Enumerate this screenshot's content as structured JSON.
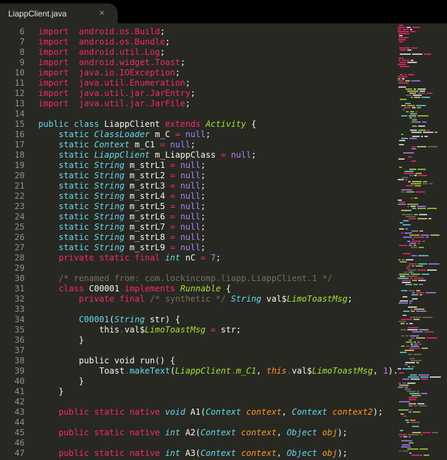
{
  "tab": {
    "filename": "LiappClient.java",
    "close_glyph": "×"
  },
  "lines": [
    {
      "n": "6",
      "tokens": [
        [
          "k",
          "import"
        ],
        [
          "",
          "  "
        ],
        [
          "k",
          "android.os.Build"
        ],
        [
          "",
          ";"
        ]
      ]
    },
    {
      "n": "7",
      "tokens": [
        [
          "k",
          "import"
        ],
        [
          "",
          "  "
        ],
        [
          "k",
          "android.os.Bundle"
        ],
        [
          "",
          ";"
        ]
      ]
    },
    {
      "n": "8",
      "tokens": [
        [
          "k",
          "import"
        ],
        [
          "",
          "  "
        ],
        [
          "k",
          "android.util.Log"
        ],
        [
          "",
          ";"
        ]
      ]
    },
    {
      "n": "9",
      "tokens": [
        [
          "k",
          "import"
        ],
        [
          "",
          "  "
        ],
        [
          "k",
          "android.widget.Toast"
        ],
        [
          "",
          ";"
        ]
      ]
    },
    {
      "n": "10",
      "tokens": [
        [
          "k",
          "import"
        ],
        [
          "",
          "  "
        ],
        [
          "k",
          "java.io.IOException"
        ],
        [
          "",
          ";"
        ]
      ]
    },
    {
      "n": "11",
      "tokens": [
        [
          "k",
          "import"
        ],
        [
          "",
          "  "
        ],
        [
          "k",
          "java.util.Enumeration"
        ],
        [
          "",
          ";"
        ]
      ]
    },
    {
      "n": "12",
      "tokens": [
        [
          "k",
          "import"
        ],
        [
          "",
          "  "
        ],
        [
          "k",
          "java.util.jar.JarEntry"
        ],
        [
          "",
          ";"
        ]
      ]
    },
    {
      "n": "13",
      "tokens": [
        [
          "k",
          "import"
        ],
        [
          "",
          "  "
        ],
        [
          "k",
          "java.util.jar.JarFile"
        ],
        [
          "",
          ";"
        ]
      ]
    },
    {
      "n": "14",
      "tokens": []
    },
    {
      "n": "15",
      "tokens": [
        [
          "f",
          "public class"
        ],
        [
          "",
          " LiappClient "
        ],
        [
          "k",
          "extends"
        ],
        [
          "",
          " "
        ],
        [
          "g",
          "Activity"
        ],
        [
          "",
          " {"
        ]
      ]
    },
    {
      "n": "16",
      "tokens": [
        [
          "",
          "    "
        ],
        [
          "f",
          "static"
        ],
        [
          "",
          " "
        ],
        [
          "t",
          "ClassLoader"
        ],
        [
          "",
          " m_C "
        ],
        [
          "k",
          "="
        ],
        [
          "",
          " "
        ],
        [
          "p",
          "null"
        ],
        [
          "",
          ";"
        ]
      ]
    },
    {
      "n": "17",
      "tokens": [
        [
          "",
          "    "
        ],
        [
          "f",
          "static"
        ],
        [
          "",
          " "
        ],
        [
          "t",
          "Context"
        ],
        [
          "",
          " m_C1 "
        ],
        [
          "k",
          "="
        ],
        [
          "",
          " "
        ],
        [
          "p",
          "null"
        ],
        [
          "",
          ";"
        ]
      ]
    },
    {
      "n": "18",
      "tokens": [
        [
          "",
          "    "
        ],
        [
          "f",
          "static"
        ],
        [
          "",
          " "
        ],
        [
          "t",
          "LiappClient"
        ],
        [
          "",
          " m_LiappClass "
        ],
        [
          "k",
          "="
        ],
        [
          "",
          " "
        ],
        [
          "p",
          "null"
        ],
        [
          "",
          ";"
        ]
      ]
    },
    {
      "n": "19",
      "tokens": [
        [
          "",
          "    "
        ],
        [
          "f",
          "static"
        ],
        [
          "",
          " "
        ],
        [
          "t",
          "String"
        ],
        [
          "",
          " m_strL1 "
        ],
        [
          "k",
          "="
        ],
        [
          "",
          " "
        ],
        [
          "p",
          "null"
        ],
        [
          "",
          ";"
        ]
      ]
    },
    {
      "n": "20",
      "tokens": [
        [
          "",
          "    "
        ],
        [
          "f",
          "static"
        ],
        [
          "",
          " "
        ],
        [
          "t",
          "String"
        ],
        [
          "",
          " m_strL2 "
        ],
        [
          "k",
          "="
        ],
        [
          "",
          " "
        ],
        [
          "p",
          "null"
        ],
        [
          "",
          ";"
        ]
      ]
    },
    {
      "n": "21",
      "tokens": [
        [
          "",
          "    "
        ],
        [
          "f",
          "static"
        ],
        [
          "",
          " "
        ],
        [
          "t",
          "String"
        ],
        [
          "",
          " m_strL3 "
        ],
        [
          "k",
          "="
        ],
        [
          "",
          " "
        ],
        [
          "p",
          "null"
        ],
        [
          "",
          ";"
        ]
      ]
    },
    {
      "n": "22",
      "tokens": [
        [
          "",
          "    "
        ],
        [
          "f",
          "static"
        ],
        [
          "",
          " "
        ],
        [
          "t",
          "String"
        ],
        [
          "",
          " m_strL4 "
        ],
        [
          "k",
          "="
        ],
        [
          "",
          " "
        ],
        [
          "p",
          "null"
        ],
        [
          "",
          ";"
        ]
      ]
    },
    {
      "n": "23",
      "tokens": [
        [
          "",
          "    "
        ],
        [
          "f",
          "static"
        ],
        [
          "",
          " "
        ],
        [
          "t",
          "String"
        ],
        [
          "",
          " m_strL5 "
        ],
        [
          "k",
          "="
        ],
        [
          "",
          " "
        ],
        [
          "p",
          "null"
        ],
        [
          "",
          ";"
        ]
      ]
    },
    {
      "n": "24",
      "tokens": [
        [
          "",
          "    "
        ],
        [
          "f",
          "static"
        ],
        [
          "",
          " "
        ],
        [
          "t",
          "String"
        ],
        [
          "",
          " m_strL6 "
        ],
        [
          "k",
          "="
        ],
        [
          "",
          " "
        ],
        [
          "p",
          "null"
        ],
        [
          "",
          ";"
        ]
      ]
    },
    {
      "n": "25",
      "tokens": [
        [
          "",
          "    "
        ],
        [
          "f",
          "static"
        ],
        [
          "",
          " "
        ],
        [
          "t",
          "String"
        ],
        [
          "",
          " m_strL7 "
        ],
        [
          "k",
          "="
        ],
        [
          "",
          " "
        ],
        [
          "p",
          "null"
        ],
        [
          "",
          ";"
        ]
      ]
    },
    {
      "n": "26",
      "tokens": [
        [
          "",
          "    "
        ],
        [
          "f",
          "static"
        ],
        [
          "",
          " "
        ],
        [
          "t",
          "String"
        ],
        [
          "",
          " m_strL8 "
        ],
        [
          "k",
          "="
        ],
        [
          "",
          " "
        ],
        [
          "p",
          "null"
        ],
        [
          "",
          ";"
        ]
      ]
    },
    {
      "n": "27",
      "tokens": [
        [
          "",
          "    "
        ],
        [
          "f",
          "static"
        ],
        [
          "",
          " "
        ],
        [
          "t",
          "String"
        ],
        [
          "",
          " m_strL9 "
        ],
        [
          "k",
          "="
        ],
        [
          "",
          " "
        ],
        [
          "p",
          "null"
        ],
        [
          "",
          ";"
        ]
      ]
    },
    {
      "n": "28",
      "tokens": [
        [
          "",
          "    "
        ],
        [
          "k",
          "private static final"
        ],
        [
          "",
          " "
        ],
        [
          "t",
          "int"
        ],
        [
          "",
          " nC "
        ],
        [
          "k",
          "="
        ],
        [
          "",
          " "
        ],
        [
          "p",
          "7"
        ],
        [
          "",
          ";"
        ]
      ]
    },
    {
      "n": "29",
      "tokens": []
    },
    {
      "n": "30",
      "tokens": [
        [
          "",
          "    "
        ],
        [
          "c",
          "/* renamed from: com.lockincomp.liapp.LiappClient.1 */"
        ]
      ]
    },
    {
      "n": "31",
      "tokens": [
        [
          "",
          "    "
        ],
        [
          "k",
          "class"
        ],
        [
          "",
          " C00001 "
        ],
        [
          "k",
          "implements"
        ],
        [
          "",
          " "
        ],
        [
          "g",
          "Runnable"
        ],
        [
          "",
          " {"
        ]
      ]
    },
    {
      "n": "32",
      "tokens": [
        [
          "",
          "        "
        ],
        [
          "k",
          "private final"
        ],
        [
          "",
          " "
        ],
        [
          "c",
          "/* synthetic */"
        ],
        [
          "",
          " "
        ],
        [
          "t",
          "String"
        ],
        [
          "",
          " val$"
        ],
        [
          "g",
          "LimoToastMsg"
        ],
        [
          "",
          ";"
        ]
      ]
    },
    {
      "n": "33",
      "tokens": []
    },
    {
      "n": "34",
      "tokens": [
        [
          "",
          "        "
        ],
        [
          "f",
          "C00001"
        ],
        [
          "",
          "("
        ],
        [
          "t",
          "String"
        ],
        [
          "",
          " str) {"
        ]
      ]
    },
    {
      "n": "35",
      "tokens": [
        [
          "",
          "            this"
        ],
        [
          "k",
          "."
        ],
        [
          "",
          "val$"
        ],
        [
          "g",
          "LimoToastMsg"
        ],
        [
          "",
          " "
        ],
        [
          "k",
          "="
        ],
        [
          "",
          " str;"
        ]
      ]
    },
    {
      "n": "36",
      "tokens": [
        [
          "",
          "        }"
        ]
      ]
    },
    {
      "n": "37",
      "tokens": []
    },
    {
      "n": "38",
      "tokens": [
        [
          "",
          "        public void run() {"
        ]
      ]
    },
    {
      "n": "39",
      "tokens": [
        [
          "",
          "            Toast"
        ],
        [
          "k",
          "."
        ],
        [
          "f",
          "makeText"
        ],
        [
          "",
          "("
        ],
        [
          "g",
          "LiappClient"
        ],
        [
          "k",
          "."
        ],
        [
          "g",
          "m_C1"
        ],
        [
          "",
          ", "
        ],
        [
          "o",
          "this"
        ],
        [
          "k",
          "."
        ],
        [
          "",
          "val$"
        ],
        [
          "g",
          "LimoToastMsg"
        ],
        [
          "",
          ", "
        ],
        [
          "p",
          "1"
        ],
        [
          "",
          ")."
        ],
        [
          "f",
          "show"
        ]
      ]
    },
    {
      "n": "40",
      "tokens": [
        [
          "",
          "        }"
        ]
      ]
    },
    {
      "n": "41",
      "tokens": [
        [
          "",
          "    }"
        ]
      ]
    },
    {
      "n": "42",
      "tokens": []
    },
    {
      "n": "43",
      "tokens": [
        [
          "",
          "    "
        ],
        [
          "k",
          "public static native"
        ],
        [
          "",
          " "
        ],
        [
          "t",
          "void"
        ],
        [
          "",
          " A1("
        ],
        [
          "t",
          "Context"
        ],
        [
          "",
          " "
        ],
        [
          "o",
          "context"
        ],
        [
          "",
          ", "
        ],
        [
          "t",
          "Context"
        ],
        [
          "",
          " "
        ],
        [
          "o",
          "context2"
        ],
        [
          "",
          ");"
        ]
      ]
    },
    {
      "n": "44",
      "tokens": []
    },
    {
      "n": "45",
      "tokens": [
        [
          "",
          "    "
        ],
        [
          "k",
          "public static native"
        ],
        [
          "",
          " "
        ],
        [
          "t",
          "int"
        ],
        [
          "",
          " A2("
        ],
        [
          "t",
          "Context"
        ],
        [
          "",
          " "
        ],
        [
          "o",
          "context"
        ],
        [
          "",
          ", "
        ],
        [
          "t",
          "Object"
        ],
        [
          "",
          " "
        ],
        [
          "o",
          "obj"
        ],
        [
          "",
          ");"
        ]
      ]
    },
    {
      "n": "46",
      "tokens": []
    },
    {
      "n": "47",
      "tokens": [
        [
          "",
          "    "
        ],
        [
          "k",
          "public static native"
        ],
        [
          "",
          " "
        ],
        [
          "t",
          "int"
        ],
        [
          "",
          " A3("
        ],
        [
          "t",
          "Context"
        ],
        [
          "",
          " "
        ],
        [
          "o",
          "context"
        ],
        [
          "",
          ", "
        ],
        [
          "t",
          "Object"
        ],
        [
          "",
          " "
        ],
        [
          "o",
          "obj"
        ],
        [
          "",
          ");"
        ]
      ]
    }
  ],
  "colors": {
    "background": "#272822",
    "tabbar": "#000000",
    "keyword": "#f92672",
    "type": "#66d9ef",
    "class_name": "#a6e22e",
    "constant": "#ae81ff",
    "comment": "#75715e",
    "parameter": "#fd971f"
  }
}
